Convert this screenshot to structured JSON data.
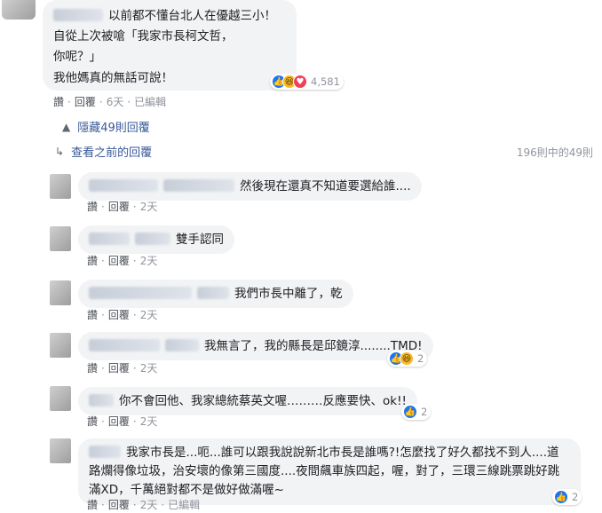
{
  "top_comment": {
    "lines": [
      "以前都不懂台北人在優越三小！",
      "自從上次被嗆「我家市長柯文哲，",
      "你呢？」",
      "我他媽真的無話可說！"
    ],
    "reaction_count": "4,581",
    "actions": {
      "read": "讚",
      "reply": "回覆",
      "time": "6天",
      "edited": "已編輯"
    }
  },
  "hide_replies": "隱藏49則回覆",
  "view_previous": "查看之前的回覆",
  "replies_counter": "196則中的49則",
  "replies": [
    {
      "text": "然後現在還真不知道要選給誰....",
      "like": "讚",
      "reply": "回覆",
      "time": "2天"
    },
    {
      "text": "雙手認同",
      "like": "讚",
      "reply": "回覆",
      "time": "2天"
    },
    {
      "text": "我們市長中離了，乾",
      "like": "讚",
      "reply": "回覆",
      "time": "2天"
    },
    {
      "text": "我無言了，我的縣長是邱鏡淳........TMD!",
      "like": "讚",
      "reply": "回覆",
      "time": "2天",
      "reactions": "2"
    },
    {
      "text": "你不會回他、我家總統蔡英文喔………反應要快、ok!!",
      "like": "讚",
      "reply": "回覆",
      "time": "2天",
      "reactions": "2"
    },
    {
      "lines": [
        "我家市長是...呃...誰可以跟我說說新北市長是誰嗎?!怎麼找了好久都找不到人....道",
        "路爛得像垃圾，治安壞的像第三國度....夜間飆車族四起，喔，對了，三環三線跳票跳好跳",
        "滿XD，千萬絕對都不是做好做滿喔~"
      ],
      "like": "讚",
      "reply": "回覆",
      "time": "2天",
      "edited": "已編輯",
      "reactions": "2"
    }
  ],
  "icons": {
    "like": "like-icon",
    "haha": "haha-icon",
    "love": "love-icon"
  }
}
